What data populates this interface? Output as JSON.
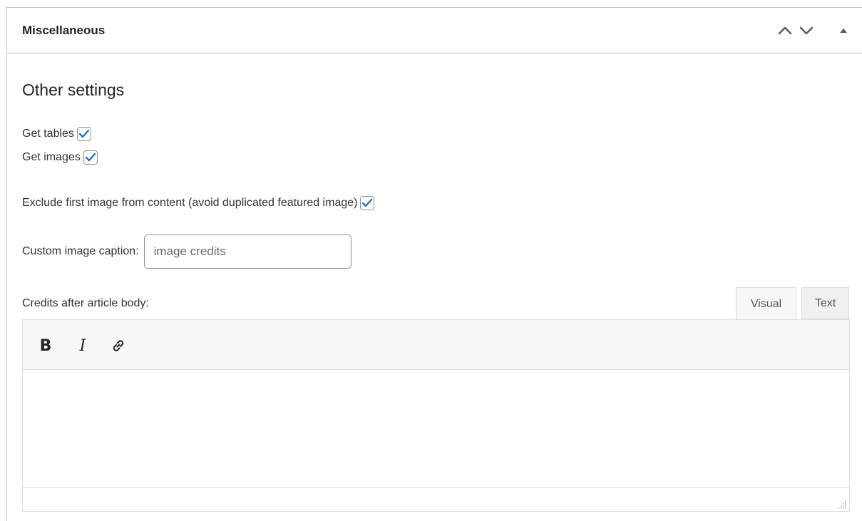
{
  "panel": {
    "title": "Miscellaneous",
    "move_up_label": "Move up",
    "move_down_label": "Move down",
    "toggle_label": "Toggle panel"
  },
  "section": {
    "title": "Other settings"
  },
  "options": {
    "get_tables": {
      "label": "Get tables",
      "checked": true
    },
    "get_images": {
      "label": "Get images",
      "checked": true
    },
    "exclude_first_image": {
      "label": "Exclude first image from content (avoid duplicated featured image)",
      "checked": true
    }
  },
  "caption": {
    "label": "Custom image caption:",
    "placeholder": "image credits",
    "value": ""
  },
  "credits": {
    "label": "Credits after article body:"
  },
  "editor": {
    "tabs": [
      {
        "label": "Visual",
        "active": true
      },
      {
        "label": "Text",
        "active": false
      }
    ],
    "toolbar": {
      "bold_label": "B",
      "italic_label": "I"
    },
    "content": ""
  },
  "colors": {
    "accent": "#2271b1",
    "border": "#c3c4c7",
    "toolbar_bg": "#f6f7f7"
  }
}
